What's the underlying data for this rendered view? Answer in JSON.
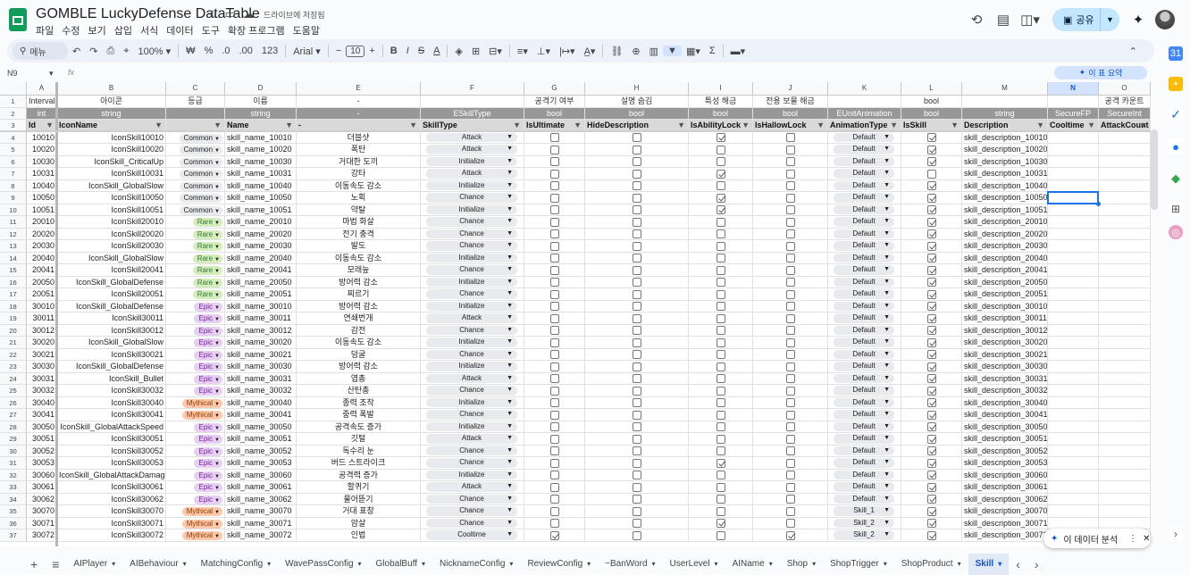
{
  "doc": {
    "title": "GOMBLE LuckyDefense DataTable",
    "saved": "드라이브에 저장됨",
    "menus": [
      "파일",
      "수정",
      "보기",
      "삽입",
      "서식",
      "데이터",
      "도구",
      "확장 프로그램",
      "도움말"
    ]
  },
  "topbar": {
    "share": "공유"
  },
  "toolbar": {
    "search": "메뉴",
    "zoom": "100%",
    "currency": "₩",
    "percent": "%",
    "dec1": ".0",
    "dec2": ".00",
    "num": "123",
    "font": "Arial",
    "fontsize": "10"
  },
  "formula": {
    "namebox": "N9",
    "fx": "fx",
    "summary": "이 표 요약"
  },
  "columns": [
    {
      "letter": "A",
      "w": 34,
      "l": 30
    },
    {
      "letter": "B",
      "w": 122,
      "l": 64
    },
    {
      "letter": "C",
      "w": 66,
      "l": 186
    },
    {
      "letter": "D",
      "w": 80,
      "l": 252
    },
    {
      "letter": "E",
      "w": 139,
      "l": 332
    },
    {
      "letter": "F",
      "w": 116,
      "l": 471
    },
    {
      "letter": "G",
      "w": 68,
      "l": 587
    },
    {
      "letter": "H",
      "w": 116,
      "l": 655
    },
    {
      "letter": "I",
      "w": 72,
      "l": 771
    },
    {
      "letter": "J",
      "w": 84,
      "l": 843
    },
    {
      "letter": "K",
      "w": 82,
      "l": 927
    },
    {
      "letter": "L",
      "w": 68,
      "l": 1009
    },
    {
      "letter": "M",
      "w": 96,
      "l": 1077
    },
    {
      "letter": "N",
      "w": 57,
      "l": 1173
    },
    {
      "letter": "O",
      "w": 58,
      "l": 1230
    }
  ],
  "header_rows": [
    [
      "Interval",
      "아이콘",
      "등급",
      "이름",
      "-",
      "",
      "공격기 여부",
      "설명 숨김",
      "특성 해금",
      "전용 보물 해금",
      "",
      "bool",
      "",
      "",
      "공격 카운트"
    ],
    [
      "int",
      "string",
      "",
      "string",
      "-",
      "ESkillType",
      "bool",
      "bool",
      "bool",
      "bool",
      "EUnitAnimation",
      "bool",
      "string",
      "SecureFP",
      "SecureInt"
    ],
    [
      "Id",
      "IconName",
      "",
      "Name",
      "-",
      "SkillType",
      "IsUltimate",
      "HideDescription",
      "IsAbilityLock",
      "IsHallowLock",
      "AnimationType",
      "IsSkill",
      "Description",
      "Cooltime",
      "AttackCount"
    ]
  ],
  "rows": [
    {
      "n": "4",
      "id": "10010",
      "icon": "IconSkill10010",
      "grade": "Common",
      "name": "skill_name_10010",
      "kr": "더블샷",
      "type": "Attack",
      "ult": false,
      "hide": false,
      "ab": true,
      "hal": false,
      "anim": "Default",
      "skill": true,
      "desc": "skill_description_10010"
    },
    {
      "n": "5",
      "id": "10020",
      "icon": "IconSkill10020",
      "grade": "Common",
      "name": "skill_name_10020",
      "kr": "폭탄",
      "type": "Attack",
      "ult": false,
      "hide": false,
      "ab": false,
      "hal": false,
      "anim": "Default",
      "skill": true,
      "desc": "skill_description_10020"
    },
    {
      "n": "6",
      "id": "10030",
      "icon": "IconSkill_CriticalUp",
      "grade": "Common",
      "name": "skill_name_10030",
      "kr": "거대한 도끼",
      "type": "Initialize",
      "ult": false,
      "hide": false,
      "ab": false,
      "hal": false,
      "anim": "Default",
      "skill": true,
      "desc": "skill_description_10030"
    },
    {
      "n": "7",
      "id": "10031",
      "icon": "IconSkill10031",
      "grade": "Common",
      "name": "skill_name_10031",
      "kr": "강타",
      "type": "Attack",
      "ult": false,
      "hide": false,
      "ab": true,
      "hal": false,
      "anim": "Default",
      "skill": false,
      "desc": "skill_description_10031"
    },
    {
      "n": "8",
      "id": "10040",
      "icon": "IconSkill_GlobalSlow",
      "grade": "Common",
      "name": "skill_name_10040",
      "kr": "이동속도 감소",
      "type": "Initialize",
      "ult": false,
      "hide": false,
      "ab": false,
      "hal": false,
      "anim": "Default",
      "skill": true,
      "desc": "skill_description_10040"
    },
    {
      "n": "9",
      "id": "10050",
      "icon": "IconSkill10050",
      "grade": "Common",
      "name": "skill_name_10050",
      "kr": "노획",
      "type": "Chance",
      "ult": false,
      "hide": false,
      "ab": true,
      "hal": false,
      "anim": "Default",
      "skill": true,
      "desc": "skill_description_10050"
    },
    {
      "n": "10",
      "id": "10051",
      "icon": "IconSkill10051",
      "grade": "Common",
      "name": "skill_name_10051",
      "kr": "약탈",
      "type": "Initialize",
      "ult": false,
      "hide": false,
      "ab": true,
      "hal": false,
      "anim": "Default",
      "skill": true,
      "desc": "skill_description_10051"
    },
    {
      "n": "11",
      "id": "20010",
      "icon": "IconSkill20010",
      "grade": "Rare",
      "name": "skill_name_20010",
      "kr": "마법 화살",
      "type": "Chance",
      "ult": false,
      "hide": false,
      "ab": false,
      "hal": false,
      "anim": "Default",
      "skill": true,
      "desc": "skill_description_20010"
    },
    {
      "n": "12",
      "id": "20020",
      "icon": "IconSkill20020",
      "grade": "Rare",
      "name": "skill_name_20020",
      "kr": "전기 충격",
      "type": "Chance",
      "ult": false,
      "hide": false,
      "ab": false,
      "hal": false,
      "anim": "Default",
      "skill": true,
      "desc": "skill_description_20020"
    },
    {
      "n": "13",
      "id": "20030",
      "icon": "IconSkill20030",
      "grade": "Rare",
      "name": "skill_name_20030",
      "kr": "발도",
      "type": "Chance",
      "ult": false,
      "hide": false,
      "ab": false,
      "hal": false,
      "anim": "Default",
      "skill": true,
      "desc": "skill_description_20030"
    },
    {
      "n": "14",
      "id": "20040",
      "icon": "IconSkill_GlobalSlow",
      "grade": "Rare",
      "name": "skill_name_20040",
      "kr": "이동속도 감소",
      "type": "Initialize",
      "ult": false,
      "hide": false,
      "ab": false,
      "hal": false,
      "anim": "Default",
      "skill": true,
      "desc": "skill_description_20040"
    },
    {
      "n": "15",
      "id": "20041",
      "icon": "IconSkill20041",
      "grade": "Rare",
      "name": "skill_name_20041",
      "kr": "모래늪",
      "type": "Chance",
      "ult": false,
      "hide": false,
      "ab": false,
      "hal": false,
      "anim": "Default",
      "skill": true,
      "desc": "skill_description_20041"
    },
    {
      "n": "16",
      "id": "20050",
      "icon": "IconSkill_GlobalDefense",
      "grade": "Rare",
      "name": "skill_name_20050",
      "kr": "방어력 감소",
      "type": "Initialize",
      "ult": false,
      "hide": false,
      "ab": false,
      "hal": false,
      "anim": "Default",
      "skill": true,
      "desc": "skill_description_20050"
    },
    {
      "n": "17",
      "id": "20051",
      "icon": "IconSkill20051",
      "grade": "Rare",
      "name": "skill_name_20051",
      "kr": "찌르기",
      "type": "Chance",
      "ult": false,
      "hide": false,
      "ab": false,
      "hal": false,
      "anim": "Default",
      "skill": true,
      "desc": "skill_description_20051"
    },
    {
      "n": "18",
      "id": "30010",
      "icon": "IconSkill_GlobalDefense",
      "grade": "Epic",
      "name": "skill_name_30010",
      "kr": "방어력 감소",
      "type": "Initialize",
      "ult": false,
      "hide": false,
      "ab": false,
      "hal": false,
      "anim": "Default",
      "skill": true,
      "desc": "skill_description_30010"
    },
    {
      "n": "19",
      "id": "30011",
      "icon": "IconSkill30011",
      "grade": "Epic",
      "name": "skill_name_30011",
      "kr": "연쇄번개",
      "type": "Attack",
      "ult": false,
      "hide": false,
      "ab": false,
      "hal": false,
      "anim": "Default",
      "skill": true,
      "desc": "skill_description_30011"
    },
    {
      "n": "20",
      "id": "30012",
      "icon": "IconSkill30012",
      "grade": "Epic",
      "name": "skill_name_30012",
      "kr": "감전",
      "type": "Chance",
      "ult": false,
      "hide": false,
      "ab": false,
      "hal": false,
      "anim": "Default",
      "skill": true,
      "desc": "skill_description_30012"
    },
    {
      "n": "21",
      "id": "30020",
      "icon": "IconSkill_GlobalSlow",
      "grade": "Epic",
      "name": "skill_name_30020",
      "kr": "이동속도 감소",
      "type": "Initialize",
      "ult": false,
      "hide": false,
      "ab": false,
      "hal": false,
      "anim": "Default",
      "skill": true,
      "desc": "skill_description_30020"
    },
    {
      "n": "22",
      "id": "30021",
      "icon": "IconSkill30021",
      "grade": "Epic",
      "name": "skill_name_30021",
      "kr": "덩굴",
      "type": "Chance",
      "ult": false,
      "hide": false,
      "ab": false,
      "hal": false,
      "anim": "Default",
      "skill": true,
      "desc": "skill_description_30021"
    },
    {
      "n": "23",
      "id": "30030",
      "icon": "IconSkill_GlobalDefense",
      "grade": "Epic",
      "name": "skill_name_30030",
      "kr": "방어력 감소",
      "type": "Initialize",
      "ult": false,
      "hide": false,
      "ab": false,
      "hal": false,
      "anim": "Default",
      "skill": true,
      "desc": "skill_description_30030"
    },
    {
      "n": "24",
      "id": "30031",
      "icon": "IconSkill_Bullet",
      "grade": "Epic",
      "name": "skill_name_30031",
      "kr": "엽총",
      "type": "Attack",
      "ult": false,
      "hide": false,
      "ab": false,
      "hal": false,
      "anim": "Default",
      "skill": true,
      "desc": "skill_description_30031"
    },
    {
      "n": "25",
      "id": "30032",
      "icon": "IconSkill30032",
      "grade": "Epic",
      "name": "skill_name_30032",
      "kr": "산탄총",
      "type": "Chance",
      "ult": false,
      "hide": false,
      "ab": false,
      "hal": false,
      "anim": "Default",
      "skill": true,
      "desc": "skill_description_30032"
    },
    {
      "n": "26",
      "id": "30040",
      "icon": "IconSkill30040",
      "grade": "Mythical",
      "name": "skill_name_30040",
      "kr": "종력 조작",
      "type": "Initialize",
      "ult": false,
      "hide": false,
      "ab": false,
      "hal": false,
      "anim": "Default",
      "skill": true,
      "desc": "skill_description_30040"
    },
    {
      "n": "27",
      "id": "30041",
      "icon": "IconSkill30041",
      "grade": "Mythical",
      "name": "skill_name_30041",
      "kr": "중력 폭발",
      "type": "Chance",
      "ult": false,
      "hide": false,
      "ab": false,
      "hal": false,
      "anim": "Default",
      "skill": true,
      "desc": "skill_description_30041"
    },
    {
      "n": "28",
      "id": "30050",
      "icon": "IconSkill_GlobalAttackSpeed",
      "grade": "Epic",
      "name": "skill_name_30050",
      "kr": "공격속도 증가",
      "type": "Initialize",
      "ult": false,
      "hide": false,
      "ab": false,
      "hal": false,
      "anim": "Default",
      "skill": true,
      "desc": "skill_description_30050"
    },
    {
      "n": "29",
      "id": "30051",
      "icon": "IconSkill30051",
      "grade": "Epic",
      "name": "skill_name_30051",
      "kr": "깃털",
      "type": "Attack",
      "ult": false,
      "hide": false,
      "ab": false,
      "hal": false,
      "anim": "Default",
      "skill": true,
      "desc": "skill_description_30051"
    },
    {
      "n": "30",
      "id": "30052",
      "icon": "IconSkill30052",
      "grade": "Epic",
      "name": "skill_name_30052",
      "kr": "독수리 눈",
      "type": "Chance",
      "ult": false,
      "hide": false,
      "ab": false,
      "hal": false,
      "anim": "Default",
      "skill": true,
      "desc": "skill_description_30052"
    },
    {
      "n": "31",
      "id": "30053",
      "icon": "IconSkill30053",
      "grade": "Epic",
      "name": "skill_name_30053",
      "kr": "버드 스트라이크",
      "type": "Chance",
      "ult": false,
      "hide": false,
      "ab": true,
      "hal": false,
      "anim": "Default",
      "skill": true,
      "desc": "skill_description_30053"
    },
    {
      "n": "32",
      "id": "30060",
      "icon": "IconSkill_GlobalAttackDamage",
      "grade": "Epic",
      "name": "skill_name_30060",
      "kr": "공격력 증가",
      "type": "Initialize",
      "ult": false,
      "hide": false,
      "ab": false,
      "hal": false,
      "anim": "Default",
      "skill": true,
      "desc": "skill_description_30060"
    },
    {
      "n": "33",
      "id": "30061",
      "icon": "IconSkill30061",
      "grade": "Epic",
      "name": "skill_name_30061",
      "kr": "할퀴기",
      "type": "Attack",
      "ult": false,
      "hide": false,
      "ab": false,
      "hal": false,
      "anim": "Default",
      "skill": true,
      "desc": "skill_description_30061"
    },
    {
      "n": "34",
      "id": "30062",
      "icon": "IconSkill30062",
      "grade": "Epic",
      "name": "skill_name_30062",
      "kr": "물어뜯기",
      "type": "Chance",
      "ult": false,
      "hide": false,
      "ab": false,
      "hal": false,
      "anim": "Default",
      "skill": true,
      "desc": "skill_description_30062"
    },
    {
      "n": "35",
      "id": "30070",
      "icon": "IconSkill30070",
      "grade": "Mythical",
      "name": "skill_name_30070",
      "kr": "거대 표창",
      "type": "Chance",
      "ult": false,
      "hide": false,
      "ab": false,
      "hal": false,
      "anim": "Skill_1",
      "skill": true,
      "desc": "skill_description_30070"
    },
    {
      "n": "36",
      "id": "30071",
      "icon": "IconSkill30071",
      "grade": "Mythical",
      "name": "skill_name_30071",
      "kr": "암살",
      "type": "Chance",
      "ult": false,
      "hide": false,
      "ab": true,
      "hal": false,
      "anim": "Skill_2",
      "skill": true,
      "desc": "skill_description_30071"
    },
    {
      "n": "37",
      "id": "30072",
      "icon": "IconSkill30072",
      "grade": "Mythical",
      "name": "skill_name_30072",
      "kr": "인법",
      "type": "Cooltime",
      "ult": true,
      "hide": false,
      "ab": false,
      "hal": true,
      "anim": "Skill_2",
      "skill": true,
      "desc": "skill_description_30072"
    }
  ],
  "grade_colors": {
    "Common": "#e8eaed",
    "Rare": "#d4edbc",
    "Epic": "#e6cff2",
    "Mythical": "#ffc8aa"
  },
  "explore": {
    "label": "이 데이터 분석"
  },
  "tabs": [
    "AIPlayer",
    "AIBehaviour",
    "MatchingConfig",
    "WavePassConfig",
    "GlobalBuff",
    "NicknameConfig",
    "ReviewConfig",
    "~BanWord",
    "UserLevel",
    "AIName",
    "Shop",
    "ShopTrigger",
    "ShopProduct",
    "Skill"
  ],
  "active_tab": "Skill"
}
